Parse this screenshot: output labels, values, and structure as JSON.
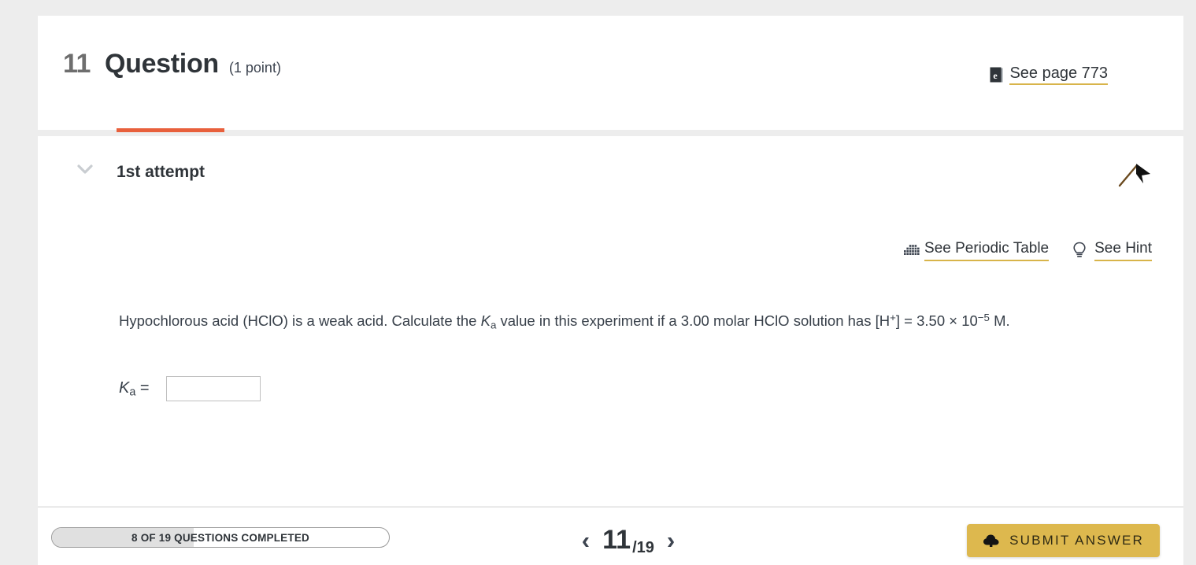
{
  "header": {
    "question_number": "11",
    "question_word": "Question",
    "points": "(1 point)",
    "see_page_label": "See page 773",
    "see_page_icon": "ebook-icon"
  },
  "attempt": {
    "label": "1st attempt",
    "collapse_icon": "chevron-down-icon",
    "flag_icon": "flag-icon"
  },
  "tools": {
    "periodic_table_label": "See Periodic Table",
    "periodic_table_icon": "periodic-table-icon",
    "hint_label": "See Hint",
    "hint_icon": "lightbulb-icon"
  },
  "question": {
    "part1": "Hypochlorous acid (HClO) is a weak acid. Calculate the ",
    "symbol_k": "K",
    "symbol_sub": "a",
    "part2": " value in this experiment if a 3.00 molar HClO solution has [H",
    "sup_plus": "+",
    "part3": "] = 3.50 × 10",
    "exponent": "−5",
    "part4": " M."
  },
  "answer": {
    "label_k": "K",
    "label_sub": "a",
    "label_eq": " =",
    "value": "",
    "placeholder": ""
  },
  "footer": {
    "progress_text": "8 OF 19 QUESTIONS COMPLETED",
    "progress_completed": 8,
    "progress_total": 19,
    "prev_icon": "chevron-left-icon",
    "next_icon": "chevron-right-icon",
    "current_page": "11",
    "page_total": "/19",
    "submit_label": "SUBMIT ANSWER",
    "submit_icon": "upload-cloud-icon"
  },
  "colors": {
    "accent_gold": "#ddb84e",
    "underline_gold": "#d8b44a",
    "tab_orange": "#e8603c",
    "page_background": "#ededed",
    "card_background": "#ffffff",
    "text_dark": "#2f3439"
  }
}
